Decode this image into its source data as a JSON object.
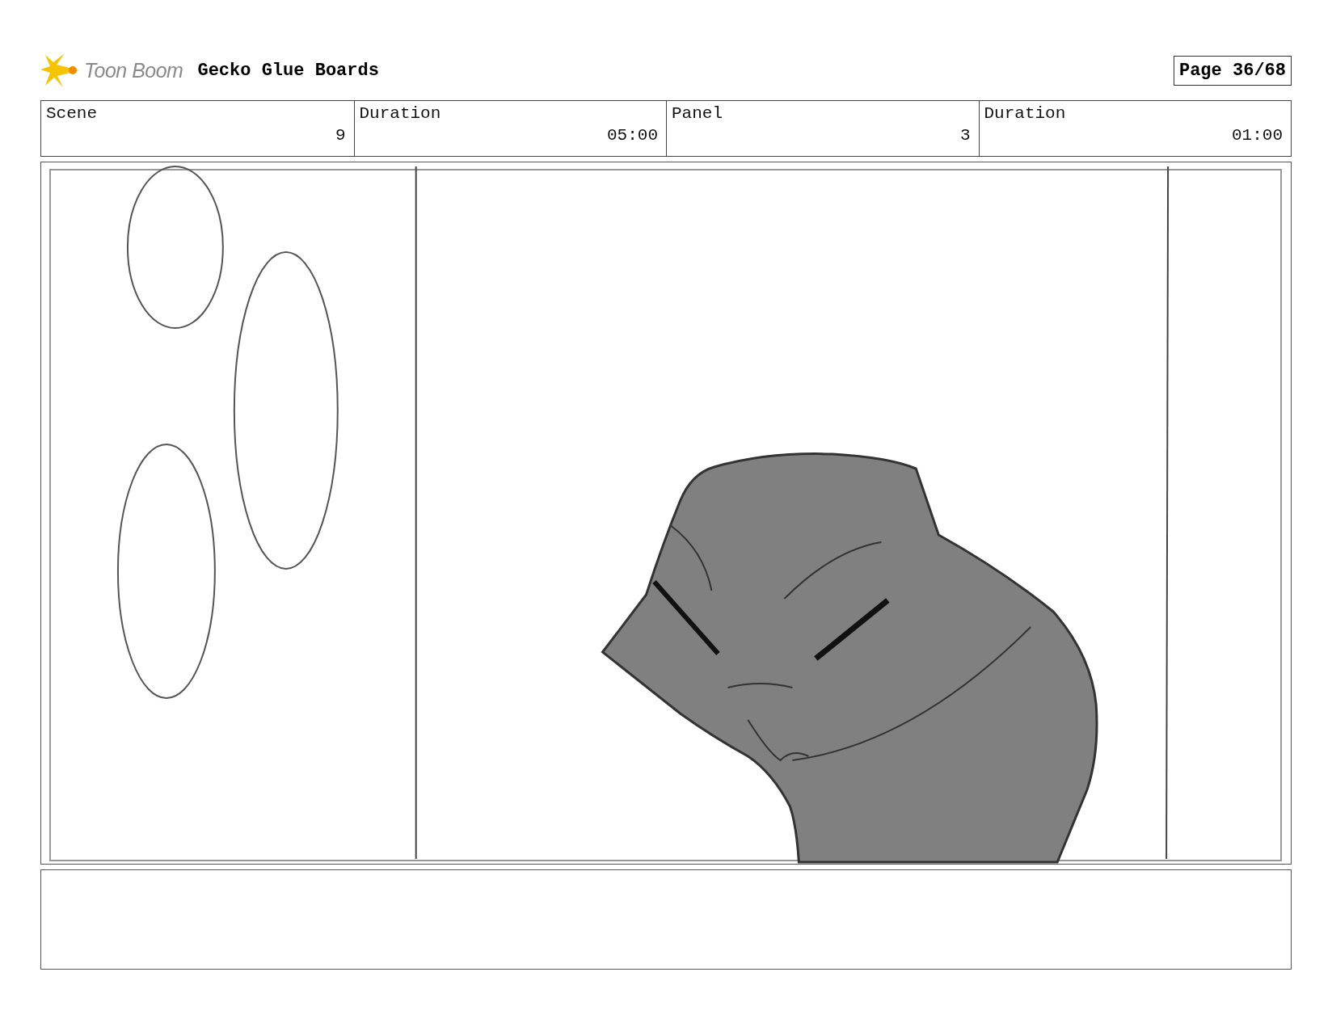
{
  "header": {
    "logo_text": "Toon Boom",
    "project_title": "Gecko Glue Boards",
    "page": "Page 36/68"
  },
  "info_table": {
    "labels": [
      "Scene",
      "Duration",
      "Panel",
      "Duration"
    ],
    "values": [
      "9",
      "05:00",
      "3",
      "01:00"
    ]
  }
}
